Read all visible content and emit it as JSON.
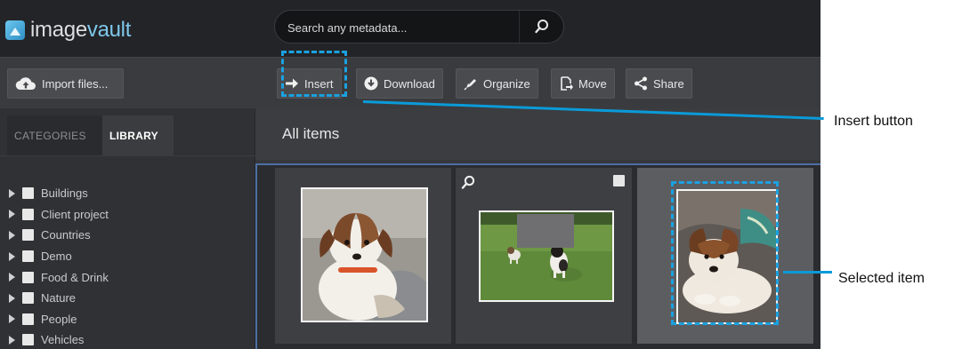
{
  "app": {
    "logo": {
      "prefix": "image",
      "suffix": "vault"
    },
    "search": {
      "placeholder": "Search any metadata..."
    }
  },
  "toolbar": {
    "import_label": "Import files...",
    "buttons": [
      {
        "label": "Insert",
        "icon": "arrow-right-icon"
      },
      {
        "label": "Download",
        "icon": "download-icon"
      },
      {
        "label": "Organize",
        "icon": "organize-icon"
      },
      {
        "label": "Move",
        "icon": "move-icon"
      },
      {
        "label": "Share",
        "icon": "share-icon"
      }
    ]
  },
  "sidebar": {
    "tabs": [
      {
        "label": "CATEGORIES",
        "active": false
      },
      {
        "label": "LIBRARY",
        "active": true
      }
    ],
    "categories": [
      "Buildings",
      "Client project",
      "Countries",
      "Demo",
      "Food & Drink",
      "Nature",
      "People",
      "Vehicles"
    ]
  },
  "main": {
    "title": "All items",
    "items": [
      {
        "alt": "puppy-sitting-photo",
        "selected": false
      },
      {
        "alt": "dogs-on-grass-photo",
        "selected": false
      },
      {
        "alt": "puppy-lying-photo",
        "selected": true
      }
    ]
  },
  "annotations": {
    "insert_label": "Insert button",
    "selected_label": "Selected item"
  },
  "colors": {
    "callout": "#1aa1e0",
    "accent": "#7ec8ec",
    "selection_border": "#4d6fa6"
  }
}
